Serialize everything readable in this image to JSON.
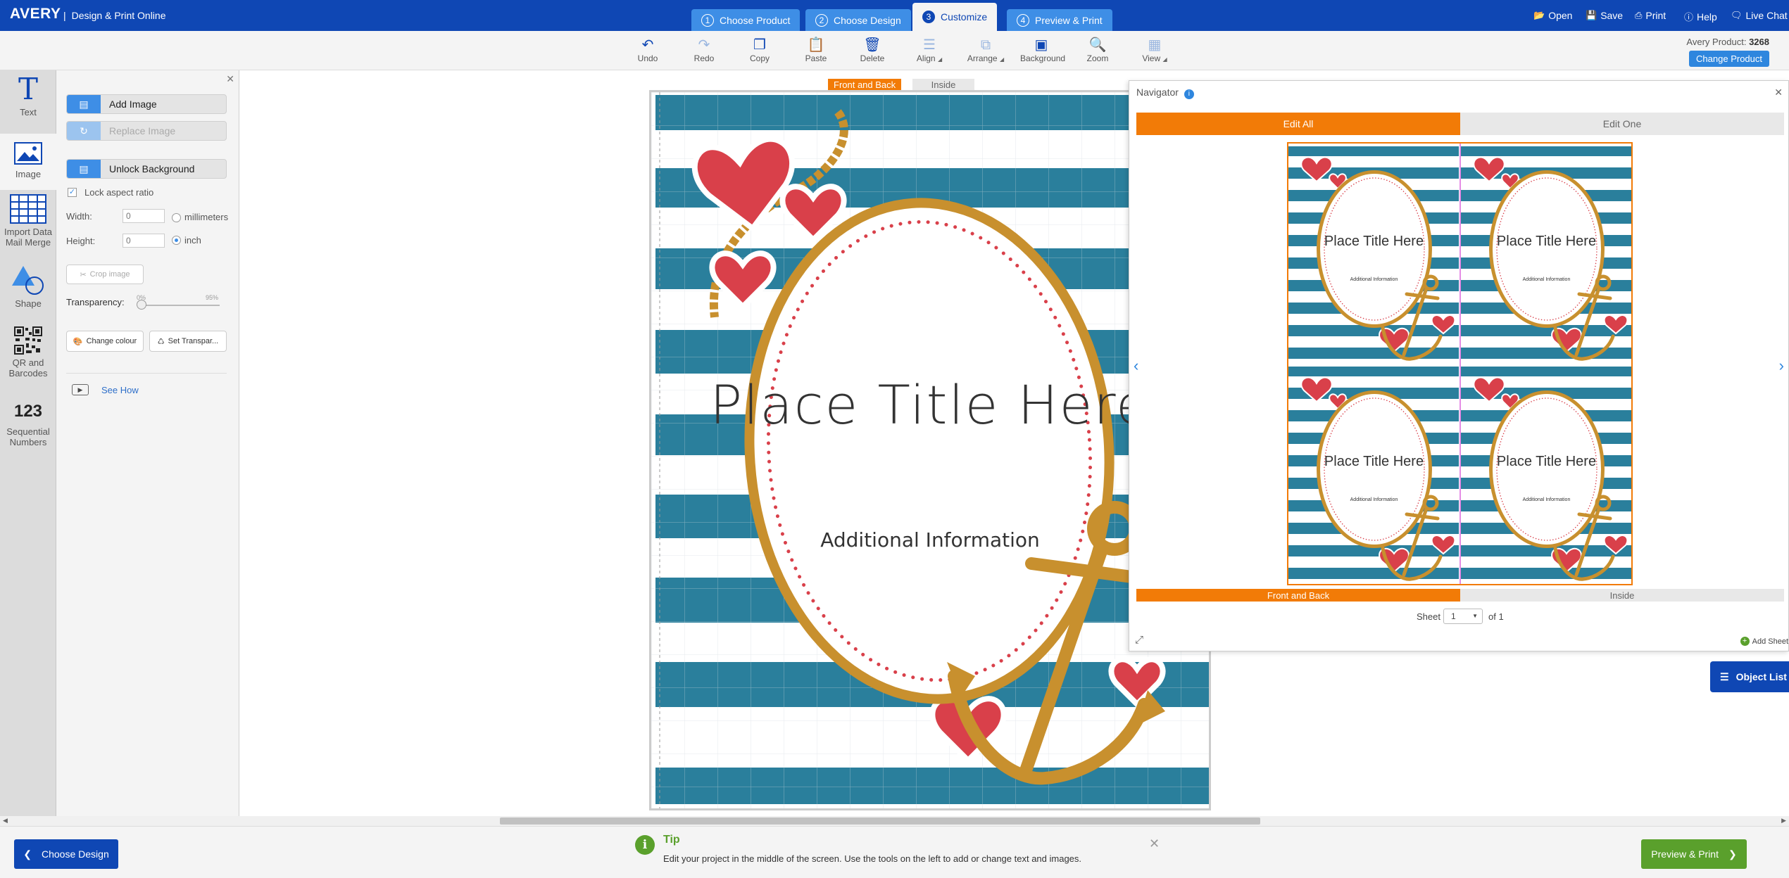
{
  "header": {
    "logo": "AVERY",
    "app_name": "Design & Print Online",
    "steps": [
      {
        "num": "1",
        "label": "Choose Product"
      },
      {
        "num": "2",
        "label": "Choose Design"
      },
      {
        "num": "3",
        "label": "Customize"
      },
      {
        "num": "4",
        "label": "Preview & Print"
      }
    ],
    "links": {
      "open": "Open",
      "save": "Save",
      "print": "Print",
      "help": "Help",
      "live_chat": "Live Chat"
    }
  },
  "toolbar": {
    "undo": "Undo",
    "redo": "Redo",
    "copy": "Copy",
    "paste": "Paste",
    "delete": "Delete",
    "align": "Align",
    "arrange": "Arrange",
    "background": "Background",
    "zoom": "Zoom",
    "view": "View",
    "product_label": "Avery Product:",
    "product_number": "3268",
    "change_product": "Change Product"
  },
  "rail": {
    "text": "Text",
    "image": "Image",
    "import_line1": "Import Data",
    "import_line2": "Mail Merge",
    "shape": "Shape",
    "qr_line1": "QR and",
    "qr_line2": "Barcodes",
    "seq_glyph": "123",
    "seq_line1": "Sequential",
    "seq_line2": "Numbers"
  },
  "panel": {
    "add_image": "Add Image",
    "replace_image": "Replace Image",
    "unlock_background": "Unlock Background",
    "lock_aspect": "Lock aspect ratio",
    "width_label": "Width:",
    "width_value": "0",
    "height_label": "Height:",
    "height_value": "0",
    "unit_mm": "millimeters",
    "unit_inch": "inch",
    "crop_image": "Crop image",
    "transparency_label": "Transparency:",
    "transparency_min": "0%",
    "transparency_max": "95%",
    "transparency_value": 0,
    "change_colour": "Change colour",
    "set_transparency": "Set Transpar...",
    "see_how": "See How"
  },
  "canvas": {
    "tab_front": "Front and Back",
    "tab_inside": "Inside",
    "title": "Place Title Here",
    "info": "Additional Information"
  },
  "navigator": {
    "title": "Navigator",
    "edit_all": "Edit All",
    "edit_one": "Edit One",
    "card_title": "Place Title Here",
    "card_info": "Additional Information",
    "tab_front": "Front and Back",
    "tab_inside": "Inside",
    "sheet_label": "Sheet",
    "sheet_value": "1",
    "sheet_of": "of 1",
    "add_sheet": "Add Sheet"
  },
  "object_list": "Object List",
  "footer": {
    "choose_design": "Choose Design",
    "tip_title": "Tip",
    "tip_text": "Edit your project in the middle of the screen. Use the tools on the left to add or change text and images.",
    "preview_print": "Preview & Print"
  },
  "colors": {
    "brand_blue": "#0f47b4",
    "step_blue": "#3e8ee6",
    "orange": "#f27b07",
    "stripe_teal": "#2a7f9c",
    "heart_red": "#d9404a",
    "gold": "#c8902e",
    "green": "#5aa02c"
  }
}
